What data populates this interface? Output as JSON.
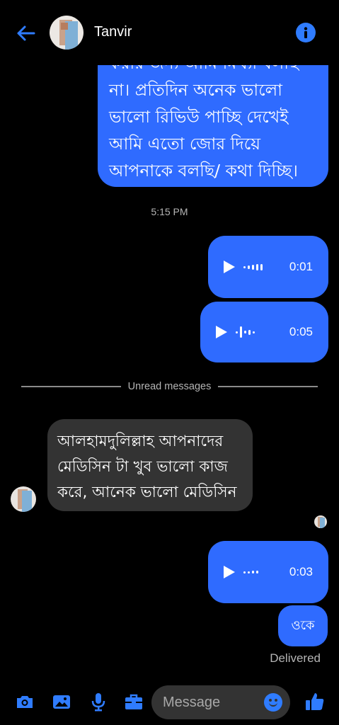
{
  "header": {
    "contact_name": "Tanvir"
  },
  "messages": {
    "outgoing_text_1": "করার জন্য আমি মিথ্যা বলছি না। প্রতিদিন অনেক ভালো ভালো রিভিউ পাচ্ছি দেখেই আমি এতো জোর দিয়ে আপনাকে বলছি/ কথা দিচ্ছি।",
    "timestamp": "5:15 PM",
    "voice_1_duration": "0:01",
    "voice_2_duration": "0:05",
    "unread_label": "Unread messages",
    "incoming_text": "আলহামদুলিল্লাহ আপনাদের মেডিসিন টা খুব ভালো কাজ করে, আনেক ভালো মেডিসিন",
    "voice_3_duration": "0:03",
    "outgoing_text_2": "ওকে",
    "status": "Delivered"
  },
  "composer": {
    "placeholder": "Message"
  },
  "colors": {
    "accent": "#2f6bff",
    "incoming_bubble": "#333333",
    "background": "#000000"
  },
  "icons": [
    "back-arrow-icon",
    "info-icon",
    "camera-icon",
    "image-icon",
    "microphone-icon",
    "briefcase-icon",
    "emoji-icon",
    "thumbs-up-icon"
  ]
}
